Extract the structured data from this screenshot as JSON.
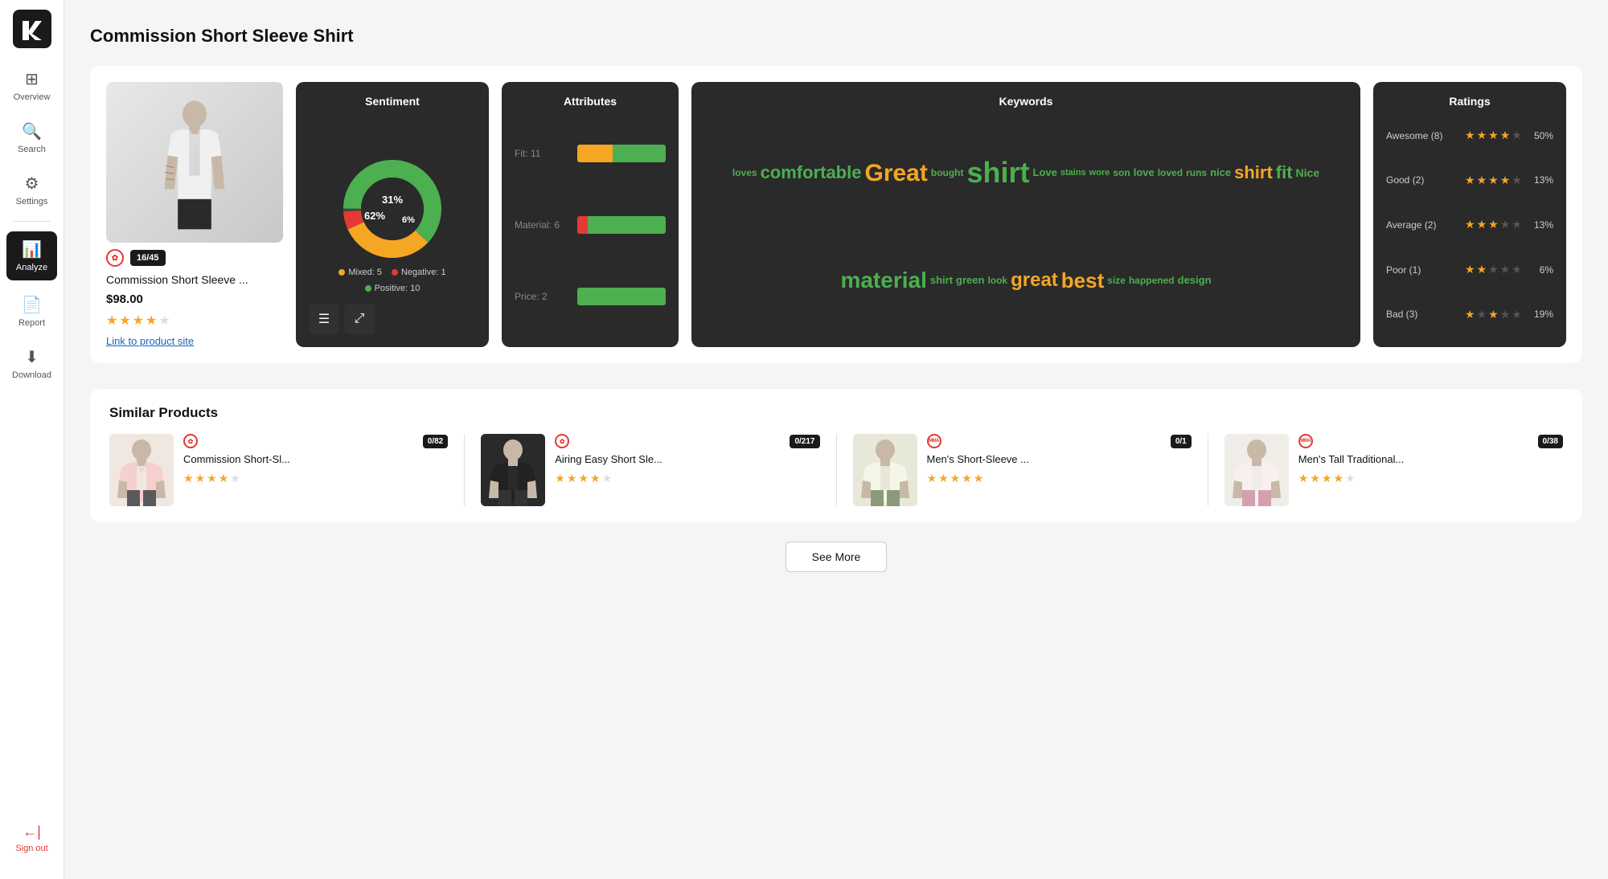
{
  "app": {
    "logo_text": "Lykdat"
  },
  "sidebar": {
    "items": [
      {
        "id": "overview",
        "label": "Overview",
        "icon": "⊞",
        "active": false
      },
      {
        "id": "search",
        "label": "Search",
        "icon": "🔍",
        "active": false
      },
      {
        "id": "settings",
        "label": "Settings",
        "icon": "⚙",
        "active": false
      }
    ],
    "active_items": [
      {
        "id": "analyze",
        "label": "Analyze",
        "icon": "📊",
        "active": true
      },
      {
        "id": "report",
        "label": "Report",
        "icon": "📄",
        "active": false
      },
      {
        "id": "download",
        "label": "Download",
        "icon": "⬇",
        "active": false
      }
    ],
    "sign_out_label": "Sign out"
  },
  "page": {
    "title": "Commission Short Sleeve Shirt"
  },
  "product": {
    "badge": "16/45",
    "name": "Commission Short Sleeve ...",
    "price": "$98.00",
    "rating_value": 3.5,
    "link_label": "Link to product site"
  },
  "sentiment": {
    "title": "Sentiment",
    "mixed_count": 5,
    "negative_count": 1,
    "positive_count": 10,
    "mixed_pct": 31,
    "negative_pct": 6,
    "positive_pct": 62,
    "mixed_label": "Mixed: 5",
    "negative_label": "Negative: 1",
    "positive_label": "Positive: 10"
  },
  "attributes": {
    "title": "Attributes",
    "rows": [
      {
        "label": "Fit: 11",
        "orange": 40,
        "green": 60,
        "red": 0
      },
      {
        "label": "Material: 6",
        "orange": 8,
        "green": 80,
        "red": 12
      },
      {
        "label": "Price: 2",
        "orange": 0,
        "green": 100,
        "red": 0
      }
    ]
  },
  "keywords": {
    "title": "Keywords",
    "words": [
      {
        "text": "comfortable",
        "size": 22,
        "color": "#4caf50"
      },
      {
        "text": "loves",
        "size": 12,
        "color": "#4caf50"
      },
      {
        "text": "Great",
        "size": 32,
        "color": "#f5a623"
      },
      {
        "text": "bought",
        "size": 12,
        "color": "#4caf50"
      },
      {
        "text": "stains",
        "size": 11,
        "color": "#4caf50"
      },
      {
        "text": "wore",
        "size": 11,
        "color": "#4caf50"
      },
      {
        "text": "shirt",
        "size": 38,
        "color": "#4caf50"
      },
      {
        "text": "Love",
        "size": 13,
        "color": "#4caf50"
      },
      {
        "text": "son",
        "size": 12,
        "color": "#4caf50"
      },
      {
        "text": "love",
        "size": 13,
        "color": "#4caf50"
      },
      {
        "text": "loved",
        "size": 12,
        "color": "#4caf50"
      },
      {
        "text": "runs",
        "size": 12,
        "color": "#4caf50"
      },
      {
        "text": "nice",
        "size": 13,
        "color": "#4caf50"
      },
      {
        "text": "shirt",
        "size": 22,
        "color": "#f5a623"
      },
      {
        "text": "fit",
        "size": 22,
        "color": "#4caf50"
      },
      {
        "text": "Nice",
        "size": 14,
        "color": "#4caf50"
      },
      {
        "text": "material",
        "size": 30,
        "color": "#4caf50"
      },
      {
        "text": "shirt",
        "size": 13,
        "color": "#4caf50"
      },
      {
        "text": "green",
        "size": 13,
        "color": "#4caf50"
      },
      {
        "text": "look",
        "size": 12,
        "color": "#4caf50"
      },
      {
        "text": "great",
        "size": 24,
        "color": "#f5a623"
      },
      {
        "text": "best",
        "size": 26,
        "color": "#f5a623"
      },
      {
        "text": "size",
        "size": 12,
        "color": "#4caf50"
      },
      {
        "text": "happened",
        "size": 12,
        "color": "#4caf50"
      },
      {
        "text": "design",
        "size": 13,
        "color": "#4caf50"
      }
    ]
  },
  "ratings": {
    "title": "Ratings",
    "rows": [
      {
        "label": "Awesome (8)",
        "stars": 4,
        "pct": "50%"
      },
      {
        "label": "Good (2)",
        "stars": 4,
        "pct": "13%"
      },
      {
        "label": "Average (2)",
        "stars": 3,
        "pct": "13%"
      },
      {
        "label": "Poor (1)",
        "stars": 2,
        "pct": "6%"
      },
      {
        "label": "Bad (3)",
        "stars": 2,
        "pct": "19%"
      }
    ]
  },
  "similar": {
    "title": "Similar Products",
    "items": [
      {
        "name": "Commission Short-Sl...",
        "badge": "0/82",
        "brand": "lulu",
        "rating": 4,
        "img_bg": "#f0e8e8"
      },
      {
        "name": "Airing Easy Short Sle...",
        "badge": "0/217",
        "brand": "lulu",
        "rating": 4,
        "img_bg": "#2a2a2a"
      },
      {
        "name": "Men's Short-Sleeve ...",
        "badge": "0/1",
        "brand": "mma",
        "rating": 5,
        "img_bg": "#e8e8e0"
      },
      {
        "name": "Men's Tall Traditional...",
        "badge": "0/38",
        "brand": "mma",
        "rating": 4,
        "img_bg": "#e8e4e0"
      }
    ],
    "see_more_label": "See More"
  }
}
